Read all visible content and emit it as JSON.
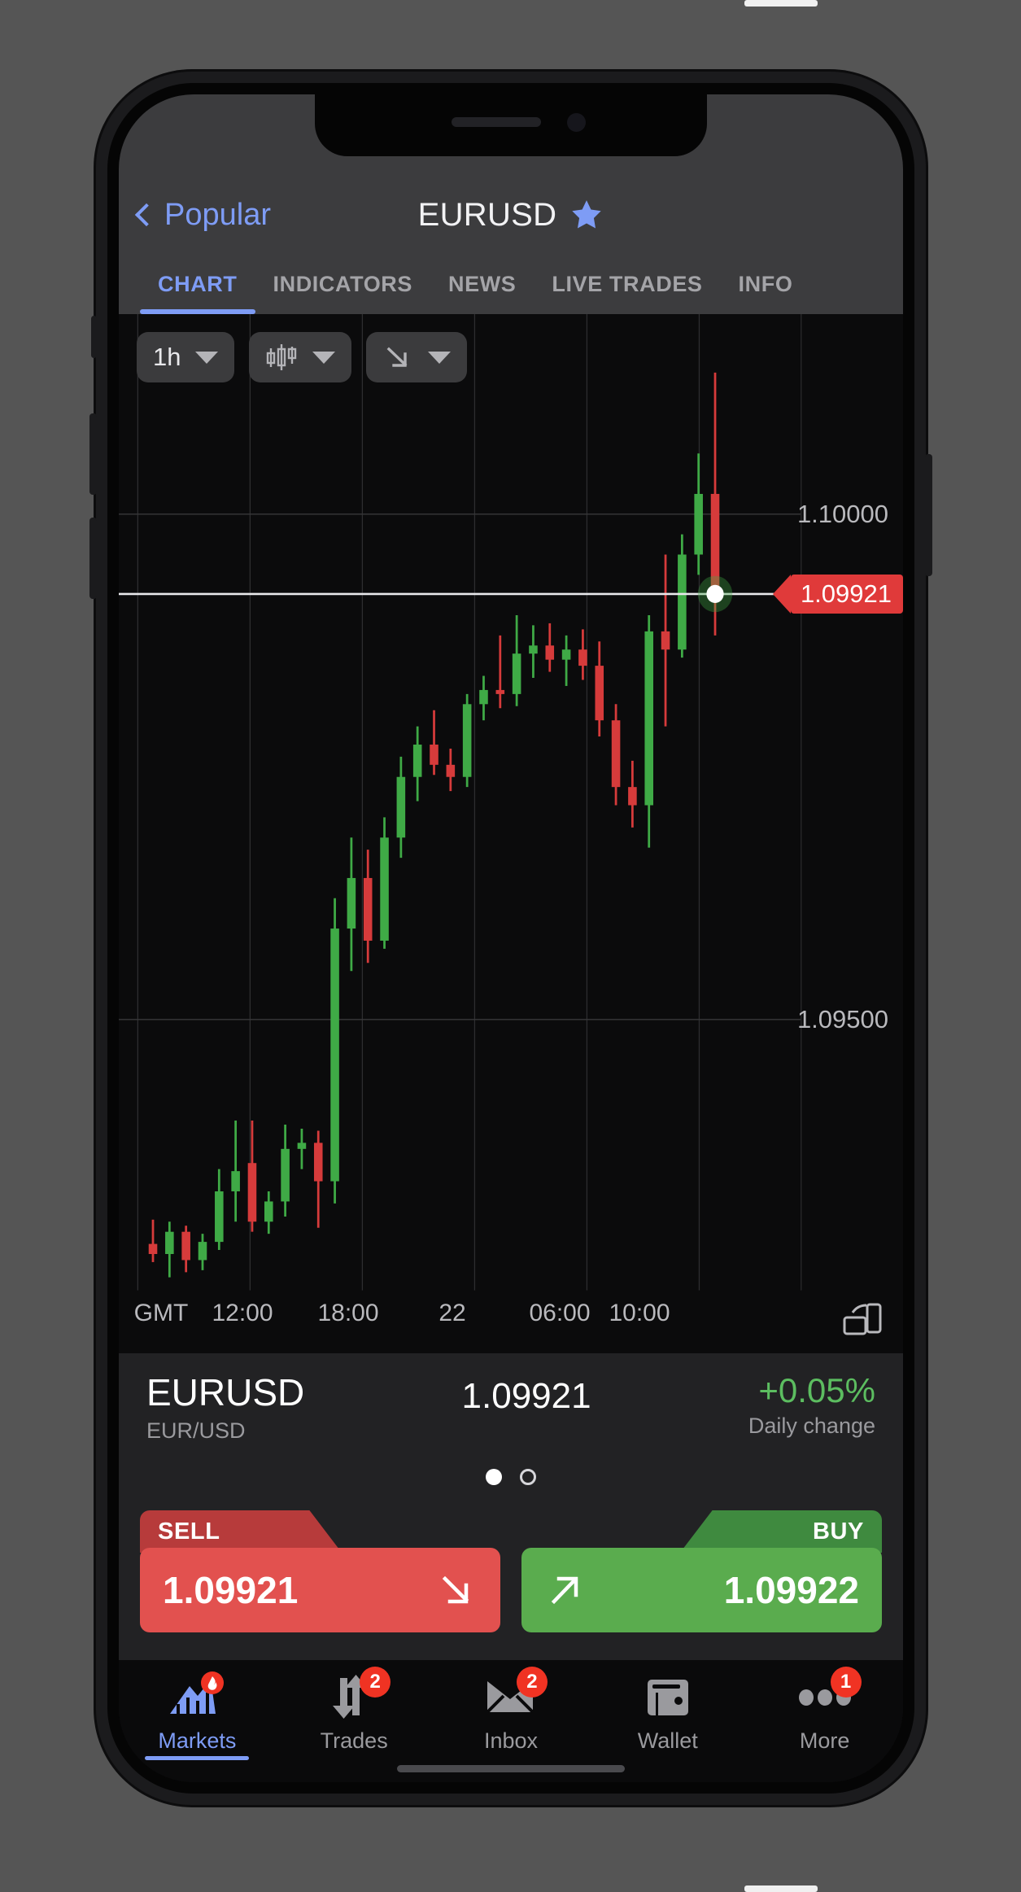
{
  "navbar": {
    "back_label": "Popular",
    "back_icon": "chevron-left-icon",
    "title": "EURUSD",
    "favorite_icon": "star-icon"
  },
  "tabs": [
    {
      "label": "CHART",
      "active": true
    },
    {
      "label": "INDICATORS",
      "active": false
    },
    {
      "label": "NEWS",
      "active": false
    },
    {
      "label": "LIVE TRADES",
      "active": false
    },
    {
      "label": "INFO",
      "active": false
    }
  ],
  "chart_toolbar": [
    {
      "label": "1h",
      "icon": "",
      "name": "timeframe-selector"
    },
    {
      "label": "",
      "icon": "candlestick-icon",
      "name": "chart-type-selector"
    },
    {
      "label": "",
      "icon": "arrow-down-right-icon",
      "name": "drawing-tool-selector"
    }
  ],
  "chart_data": {
    "type": "candlestick",
    "title": "EURUSD 1h",
    "xlabel": "",
    "ylabel": "",
    "timezone_label": "GMT",
    "time_ticks": [
      "12:00",
      "18:00",
      "22",
      "06:00",
      "10:00"
    ],
    "price_ticks": [
      "1.10000",
      "1.09500"
    ],
    "ylim": [
      1.0925,
      1.1018
    ],
    "current_price": "1.09921",
    "current_price_color": "#e03a3a",
    "up_color": "#3faa46",
    "down_color": "#d63b3b",
    "grid": true,
    "candles": [
      {
        "o": 1.09278,
        "h": 1.09302,
        "l": 1.0926,
        "c": 1.09268,
        "dir": "down"
      },
      {
        "o": 1.09268,
        "h": 1.093,
        "l": 1.09245,
        "c": 1.0929,
        "dir": "up"
      },
      {
        "o": 1.0929,
        "h": 1.09296,
        "l": 1.0925,
        "c": 1.09262,
        "dir": "down"
      },
      {
        "o": 1.09262,
        "h": 1.09288,
        "l": 1.09252,
        "c": 1.0928,
        "dir": "up"
      },
      {
        "o": 1.0928,
        "h": 1.09352,
        "l": 1.09272,
        "c": 1.0933,
        "dir": "up"
      },
      {
        "o": 1.0933,
        "h": 1.094,
        "l": 1.093,
        "c": 1.0935,
        "dir": "up"
      },
      {
        "o": 1.09358,
        "h": 1.094,
        "l": 1.0929,
        "c": 1.093,
        "dir": "down"
      },
      {
        "o": 1.093,
        "h": 1.0933,
        "l": 1.09288,
        "c": 1.0932,
        "dir": "up"
      },
      {
        "o": 1.0932,
        "h": 1.09396,
        "l": 1.09305,
        "c": 1.09372,
        "dir": "up"
      },
      {
        "o": 1.09372,
        "h": 1.09392,
        "l": 1.09352,
        "c": 1.09378,
        "dir": "up"
      },
      {
        "o": 1.09378,
        "h": 1.0939,
        "l": 1.09294,
        "c": 1.0934,
        "dir": "down"
      },
      {
        "o": 1.0934,
        "h": 1.0962,
        "l": 1.09318,
        "c": 1.0959,
        "dir": "up"
      },
      {
        "o": 1.0959,
        "h": 1.0968,
        "l": 1.09548,
        "c": 1.0964,
        "dir": "up"
      },
      {
        "o": 1.0964,
        "h": 1.09668,
        "l": 1.09556,
        "c": 1.09578,
        "dir": "down"
      },
      {
        "o": 1.09578,
        "h": 1.097,
        "l": 1.0957,
        "c": 1.0968,
        "dir": "up"
      },
      {
        "o": 1.0968,
        "h": 1.0976,
        "l": 1.0966,
        "c": 1.0974,
        "dir": "up"
      },
      {
        "o": 1.0974,
        "h": 1.0979,
        "l": 1.09716,
        "c": 1.09772,
        "dir": "up"
      },
      {
        "o": 1.09772,
        "h": 1.09806,
        "l": 1.09742,
        "c": 1.09752,
        "dir": "down"
      },
      {
        "o": 1.09752,
        "h": 1.09768,
        "l": 1.09726,
        "c": 1.0974,
        "dir": "down"
      },
      {
        "o": 1.0974,
        "h": 1.09822,
        "l": 1.0973,
        "c": 1.09812,
        "dir": "up"
      },
      {
        "o": 1.09812,
        "h": 1.0984,
        "l": 1.09796,
        "c": 1.09826,
        "dir": "up"
      },
      {
        "o": 1.09826,
        "h": 1.0988,
        "l": 1.09808,
        "c": 1.09822,
        "dir": "down"
      },
      {
        "o": 1.09822,
        "h": 1.099,
        "l": 1.0981,
        "c": 1.09862,
        "dir": "up"
      },
      {
        "o": 1.09862,
        "h": 1.0989,
        "l": 1.09838,
        "c": 1.0987,
        "dir": "up"
      },
      {
        "o": 1.0987,
        "h": 1.09892,
        "l": 1.09844,
        "c": 1.09856,
        "dir": "down"
      },
      {
        "o": 1.09856,
        "h": 1.0988,
        "l": 1.0983,
        "c": 1.09866,
        "dir": "up"
      },
      {
        "o": 1.09866,
        "h": 1.09886,
        "l": 1.09836,
        "c": 1.0985,
        "dir": "down"
      },
      {
        "o": 1.0985,
        "h": 1.09874,
        "l": 1.0978,
        "c": 1.09796,
        "dir": "down"
      },
      {
        "o": 1.09796,
        "h": 1.09812,
        "l": 1.09712,
        "c": 1.0973,
        "dir": "down"
      },
      {
        "o": 1.0973,
        "h": 1.09756,
        "l": 1.0969,
        "c": 1.09712,
        "dir": "down"
      },
      {
        "o": 1.09712,
        "h": 1.099,
        "l": 1.0967,
        "c": 1.09884,
        "dir": "up"
      },
      {
        "o": 1.09884,
        "h": 1.0996,
        "l": 1.0979,
        "c": 1.09866,
        "dir": "down"
      },
      {
        "o": 1.09866,
        "h": 1.0998,
        "l": 1.09858,
        "c": 1.0996,
        "dir": "up"
      },
      {
        "o": 1.0996,
        "h": 1.1006,
        "l": 1.0994,
        "c": 1.1002,
        "dir": "up"
      },
      {
        "o": 1.1002,
        "h": 1.1014,
        "l": 1.0988,
        "c": 1.09921,
        "dir": "down"
      }
    ]
  },
  "quote": {
    "symbol": "EURUSD",
    "subtitle": "EUR/USD",
    "price": "1.09921",
    "change": "+0.05%",
    "change_label": "Daily change",
    "change_color": "#5cbd60"
  },
  "pager": {
    "total": 2,
    "active_index": 0
  },
  "trade": {
    "sell": {
      "flap": "SELL",
      "price": "1.09921",
      "icon": "arrow-down-right-icon",
      "color": "#e2514f"
    },
    "buy": {
      "flap": "BUY",
      "price": "1.09922",
      "icon": "arrow-up-right-icon",
      "color": "#5aac4e"
    }
  },
  "bottom_nav": [
    {
      "label": "Markets",
      "icon": "markets-flame-icon",
      "badge": "",
      "active": true
    },
    {
      "label": "Trades",
      "icon": "trades-arrows-icon",
      "badge": "2",
      "active": false
    },
    {
      "label": "Inbox",
      "icon": "envelope-icon",
      "badge": "2",
      "active": false
    },
    {
      "label": "Wallet",
      "icon": "wallet-icon",
      "badge": "",
      "active": false
    },
    {
      "label": "More",
      "icon": "ellipsis-icon",
      "badge": "1",
      "active": false
    }
  ]
}
